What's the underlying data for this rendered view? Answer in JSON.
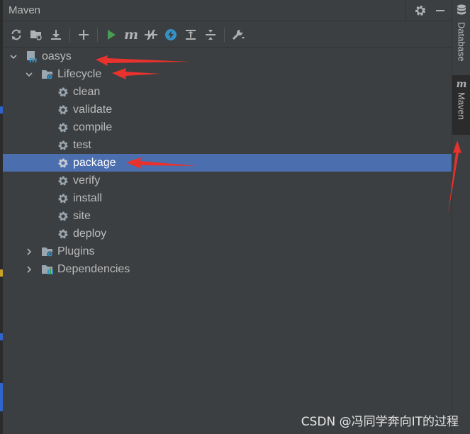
{
  "panel": {
    "title": "Maven",
    "settings_icon": "gear-icon",
    "minimize_icon": "minimize-icon"
  },
  "toolbar": {
    "buttons": [
      {
        "name": "reload-all-button",
        "icon": "reload-icon"
      },
      {
        "name": "generate-sources-button",
        "icon": "folder-sync-icon"
      },
      {
        "name": "download-sources-button",
        "icon": "download-icon"
      },
      {
        "name": "add-project-button",
        "icon": "plus-icon"
      },
      {
        "name": "run-button",
        "icon": "play-icon"
      },
      {
        "name": "execute-goal-button",
        "icon": "maven-m-icon"
      },
      {
        "name": "toggle-offline-button",
        "icon": "offline-icon"
      },
      {
        "name": "skip-tests-button",
        "icon": "lightning-icon"
      },
      {
        "name": "show-dependencies-button",
        "icon": "diagram-icon"
      },
      {
        "name": "collapse-all-button",
        "icon": "collapse-icon"
      },
      {
        "name": "maven-settings-button",
        "icon": "wrench-icon"
      }
    ]
  },
  "tree": {
    "root": "oasys",
    "lifecycle": "Lifecycle",
    "phases": [
      "clean",
      "validate",
      "compile",
      "test",
      "package",
      "verify",
      "install",
      "site",
      "deploy"
    ],
    "selected_phase": "package",
    "plugins": "Plugins",
    "dependencies": "Dependencies"
  },
  "sidebar": {
    "database_label": "Database",
    "maven_label": "Maven"
  },
  "watermark": "CSDN @冯同学奔向IT的过程",
  "colors": {
    "background": "#3c3f41",
    "selection": "#4b6eaf",
    "arrow_annotation": "#e8322d",
    "run_green": "#499c54",
    "accent_blue": "#3592c4"
  }
}
